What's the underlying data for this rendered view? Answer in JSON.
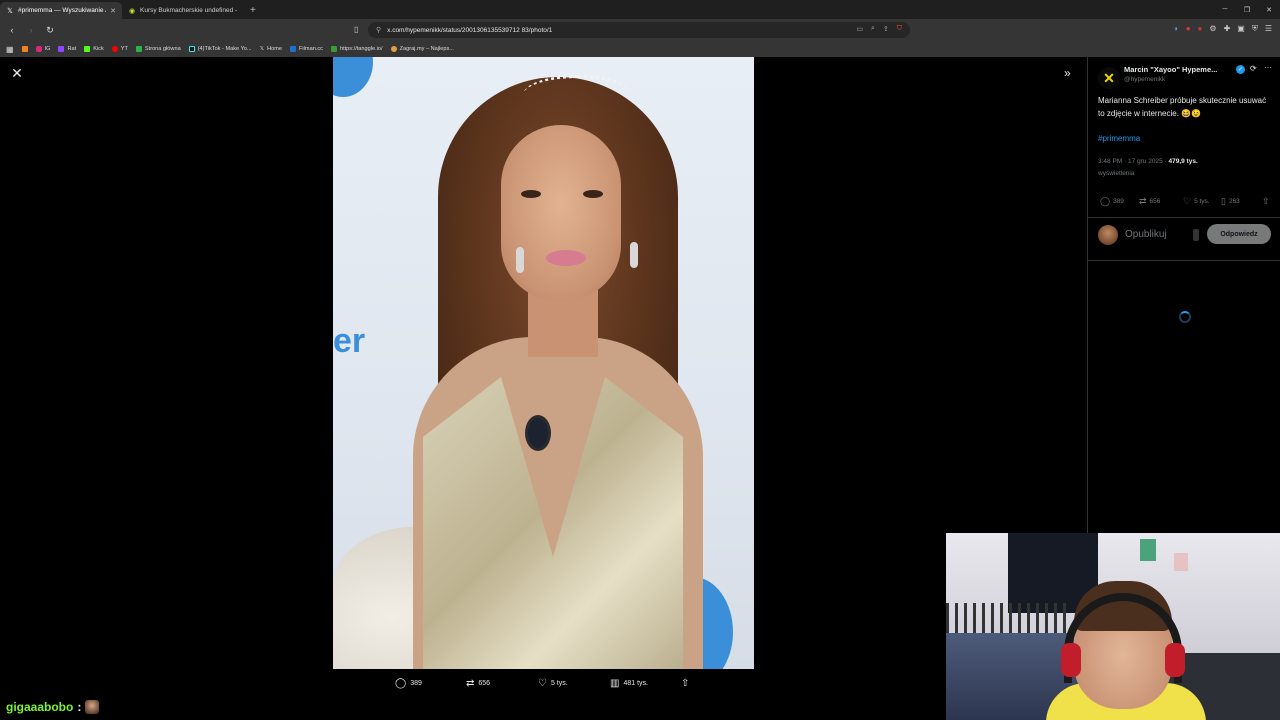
{
  "browser": {
    "tabs": [
      {
        "title": "#primemma — Wyszukiwanie /",
        "active": true,
        "icon": "x-logo-icon"
      },
      {
        "title": "Kursy Bukmacherskie undefined - Ot",
        "active": false,
        "icon": "betting-site-icon"
      }
    ],
    "url": "x.com/hypemenikk/status/2001306135539712 83/photo/1",
    "bookmarks": [
      "IG",
      "Rat",
      "Kick",
      "YT",
      "Strona główna",
      "(4)TikTok - Make Yo...",
      "Home",
      "Filman.cc",
      "https://tanggle.io/",
      "Zagraj.my – Najleps..."
    ]
  },
  "viewer": {
    "actions": {
      "replies": "389",
      "reposts": "656",
      "likes": "5 tys.",
      "views": "481 tys."
    }
  },
  "post": {
    "author_name": "Marcin \"Xayoo\" Hypeme...",
    "author_handle": "@hypemenikk",
    "text": "Marianna Schreiber próbuje skutecznie usuwać to zdjęcie w internecie. 😆😉",
    "hashtag": "#primemma",
    "time": "3:48 PM · 17 gru 2025 · ",
    "views_count": "479,9 tys.",
    "views_label": "wyświetlenia",
    "stats": {
      "replies": "389",
      "reposts": "656",
      "likes": "5 tys.",
      "bookmarks": "263"
    },
    "reply_placeholder": "Opublikuj",
    "reply_button": "Odpowiedz"
  },
  "chat": {
    "username": "gigaaabobo",
    "separator": ":"
  },
  "colors": {
    "accent": "#1d9bf0",
    "chat_name": "#7cf23a",
    "background": "#000000"
  }
}
